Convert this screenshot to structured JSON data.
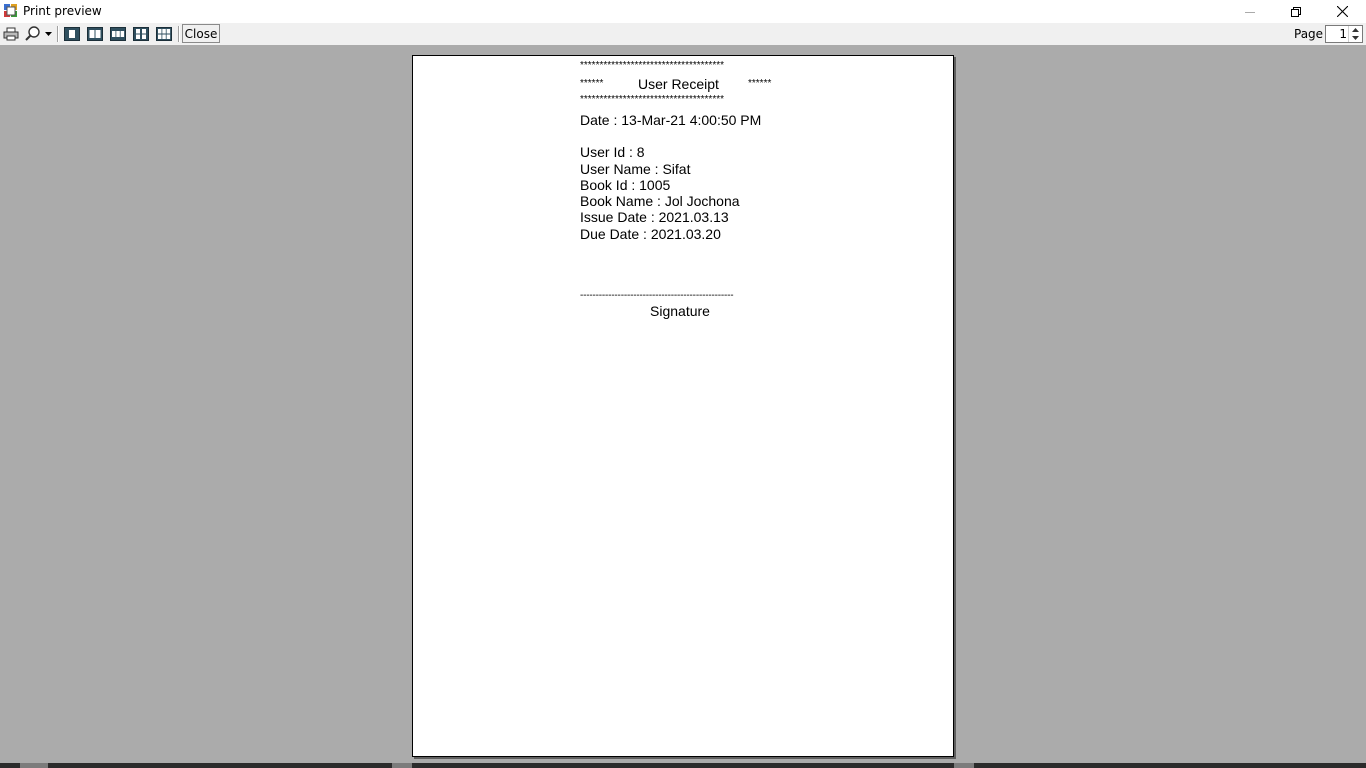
{
  "window": {
    "title": "Print preview",
    "icon": "print-preview-icon"
  },
  "toolbar": {
    "icons": [
      "printer-icon",
      "zoom-icon",
      "dropdown-arrow-icon",
      "one-page-icon",
      "two-pages-icon",
      "three-pages-icon",
      "four-pages-icon",
      "six-pages-icon"
    ],
    "close_label": "Close",
    "page_label": "Page",
    "page_value": "1"
  },
  "receipt": {
    "stars_top": "*************************************",
    "stars_left": "******",
    "title": "User Receipt",
    "stars_right": "******",
    "stars_bottom": "*************************************",
    "date": "Date : 13-Mar-21 4:00:50 PM",
    "user_id": "User Id : 8",
    "user_name": "User Name : Sifat",
    "book_id": "Book Id : 1005",
    "book_name": "Book Name : Jol Jochona",
    "issue_date": "Issue Date : 2021.03.13",
    "due_date": "Due Date : 2021.03.20",
    "signature_line": "-------------------------------------------------",
    "signature_label": "Signature"
  }
}
